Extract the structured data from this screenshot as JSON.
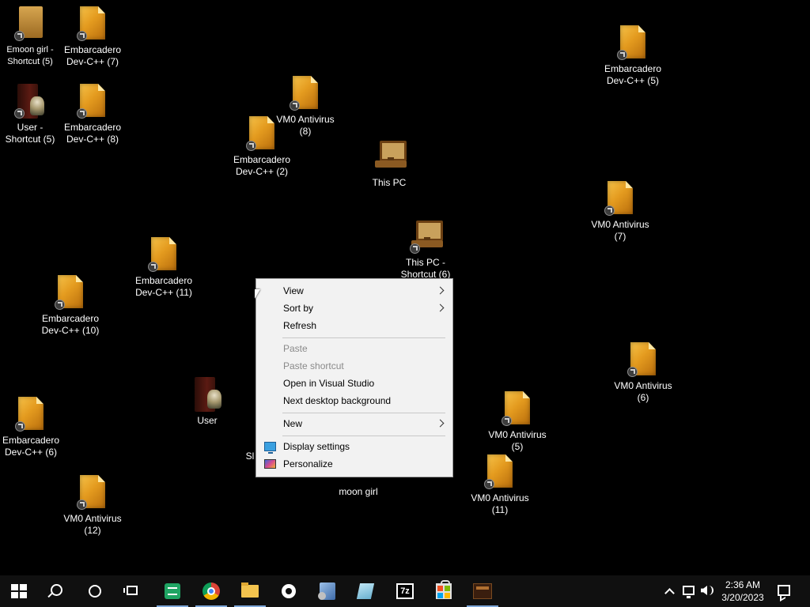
{
  "desktop": {
    "icons": [
      {
        "label": "Emoon girl - Shortcut (5)"
      },
      {
        "label": "Embarcadero\nDev-C++ (7)"
      },
      {
        "label": "User -\nShortcut (5)"
      },
      {
        "label": "Embarcadero\nDev-C++ (8)"
      },
      {
        "label": "VM0 Antivirus\n(8)"
      },
      {
        "label": "Embarcadero\nDev-C++ (2)"
      },
      {
        "label": "This PC"
      },
      {
        "label": "Embarcadero\nDev-C++ (5)"
      },
      {
        "label": "VM0 Antivirus\n(7)"
      },
      {
        "label": "This PC -\nShortcut (6)"
      },
      {
        "label": "Embarcadero\nDev-C++ (11)"
      },
      {
        "label": "Embarcadero\nDev-C++ (10)"
      },
      {
        "label": "User"
      },
      {
        "label": "VM0 Antivirus\n(6)"
      },
      {
        "label": "Embarcadero\nDev-C++ (6)"
      },
      {
        "label": "VM0 Antivirus\n(5)"
      },
      {
        "label": "VM0 Antivirus\n(11)"
      },
      {
        "label": "moon girl"
      },
      {
        "label": "VM0 Antivirus\n(12)"
      },
      {
        "label": "Sl"
      }
    ]
  },
  "context_menu": {
    "items": [
      {
        "label": "View",
        "submenu": true,
        "enabled": true
      },
      {
        "label": "Sort by",
        "submenu": true,
        "enabled": true
      },
      {
        "label": "Refresh",
        "enabled": true
      },
      {
        "label": "Paste",
        "enabled": false
      },
      {
        "label": "Paste shortcut",
        "enabled": false
      },
      {
        "label": "Open in Visual Studio",
        "enabled": true
      },
      {
        "label": "Next desktop background",
        "enabled": true
      },
      {
        "label": "New",
        "submenu": true,
        "enabled": true
      },
      {
        "label": "Display settings",
        "icon": "monitor-icon",
        "enabled": true
      },
      {
        "label": "Personalize",
        "icon": "personalize-icon",
        "enabled": true
      }
    ]
  },
  "taskbar": {
    "buttons": [
      {
        "name": "start",
        "icon": "windows-logo-icon"
      },
      {
        "name": "search",
        "icon": "search-icon"
      },
      {
        "name": "cortana",
        "icon": "cortana-icon"
      },
      {
        "name": "task-view",
        "icon": "task-view-icon"
      },
      {
        "name": "google-sheets",
        "icon": "sheets-icon",
        "running": true
      },
      {
        "name": "chrome",
        "icon": "chrome-icon",
        "running": true
      },
      {
        "name": "file-explorer",
        "icon": "folder-icon",
        "running": true
      },
      {
        "name": "settings",
        "icon": "gear-icon"
      },
      {
        "name": "tool-app",
        "icon": "tool-icon"
      },
      {
        "name": "notes-app",
        "icon": "notes-icon"
      },
      {
        "name": "7-zip",
        "icon": "7zip-icon",
        "text": "7z"
      },
      {
        "name": "microsoft-store",
        "icon": "store-icon"
      },
      {
        "name": "game-app",
        "icon": "app-icon",
        "running": true
      }
    ],
    "tray": {
      "time": "2:36 AM",
      "date": "3/20/2023"
    }
  },
  "colors": {
    "desktop_bg": "#000000",
    "taskbar_bg": "#101010",
    "menu_bg": "#f2f2f2",
    "running_indicator": "#7ea7d8"
  }
}
